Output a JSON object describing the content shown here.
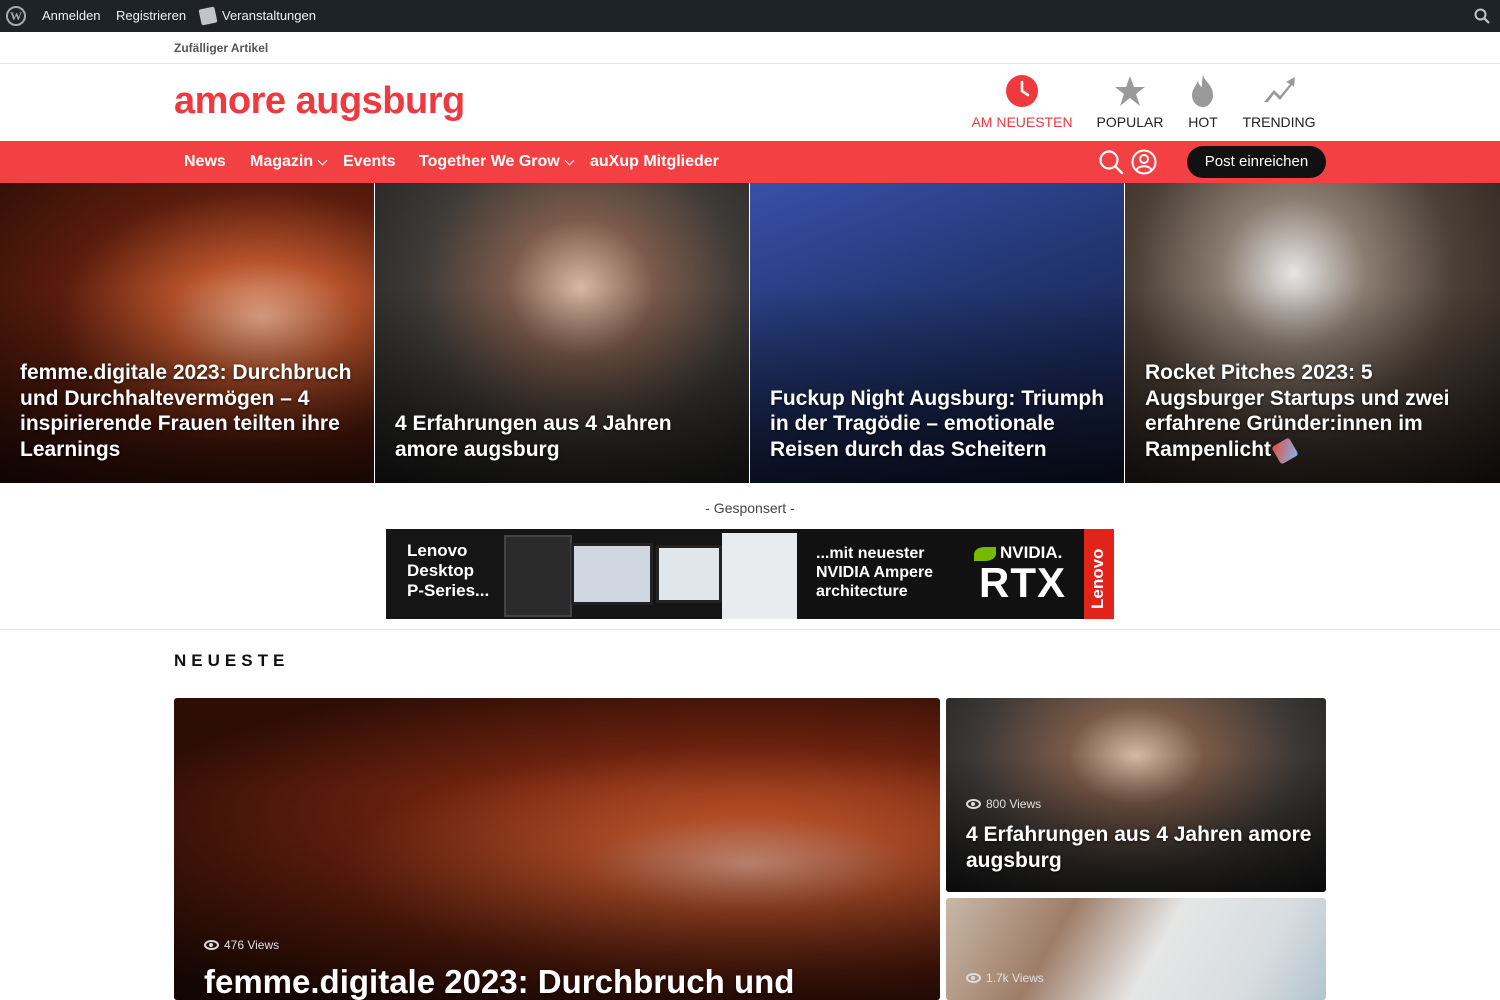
{
  "adminbar": {
    "login": "Anmelden",
    "register": "Registrieren",
    "events": "Veranstaltungen"
  },
  "toprow": {
    "random": "Zufälliger Artikel"
  },
  "site": {
    "title": "amore augsburg",
    "brand_color": "#ee3a3e"
  },
  "header_nav": [
    {
      "label": "AM NEUESTEN",
      "icon": "clock-icon",
      "active": true
    },
    {
      "label": "POPULAR",
      "icon": "star-icon",
      "active": false
    },
    {
      "label": "HOT",
      "icon": "flame-icon",
      "active": false
    },
    {
      "label": "TRENDING",
      "icon": "trending-up-icon",
      "active": false
    }
  ],
  "menu": {
    "items": [
      "News",
      "Magazin",
      "Events",
      "Together We Grow",
      "auXup Mitglieder"
    ],
    "post_button": "Post einreichen"
  },
  "hero": [
    {
      "title": "femme.digitale 2023: Durchbruch und Durchhaltevermögen – 4 inspirierende Frauen teilten ihre Learnings"
    },
    {
      "title": "4 Erfahrungen aus 4 Jahren amore augsburg"
    },
    {
      "title": "Fuckup Night Augsburg: Triumph in der Tragödie – emotionale Reisen durch das Scheitern"
    },
    {
      "title": "Rocket Pitches 2023: 5 Augsburger Startups und zwei erfahrene Gründer:innen im Rampenlicht"
    }
  ],
  "sponsored": {
    "label": "- Gesponsert -",
    "ad_left": "Lenovo\nDesktop\nP-Series...",
    "ad_right": "...mit neuester\nNVIDIA Ampere\narchitecture",
    "nvidia": "NVIDIA.",
    "rtx": "RTX",
    "lenovo": "Lenovo"
  },
  "latest": {
    "heading": "NEUESTE",
    "cards": [
      {
        "views": "476 Views",
        "title": "femme.digitale 2023: Durchbruch und"
      },
      {
        "views": "800 Views",
        "title": "4 Erfahrungen aus 4 Jahren amore augsburg"
      },
      {
        "views": "1.7k Views",
        "title": ""
      }
    ]
  }
}
